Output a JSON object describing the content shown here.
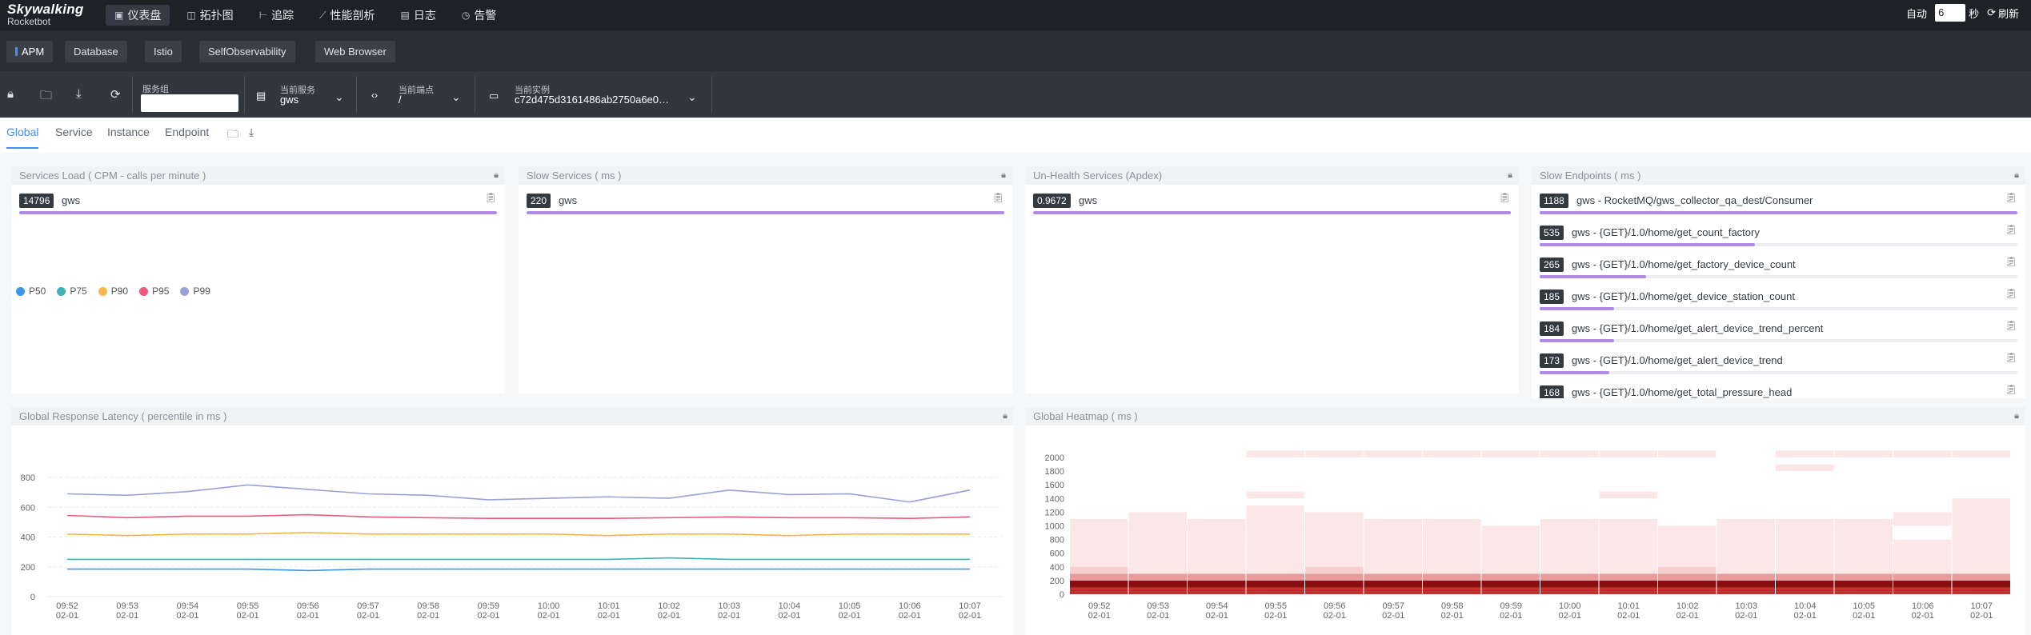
{
  "app": {
    "logo_main": "Skywalking",
    "logo_sub": "Rocketbot"
  },
  "nav": [
    {
      "label": "仪表盘",
      "icon": "dashboard-icon",
      "glyph": "▣",
      "active": true
    },
    {
      "label": "拓扑图",
      "icon": "topology-icon",
      "glyph": "◫"
    },
    {
      "label": "追踪",
      "icon": "trace-icon",
      "glyph": "⊢"
    },
    {
      "label": "性能剖析",
      "icon": "profile-icon",
      "glyph": "⟋"
    },
    {
      "label": "日志",
      "icon": "log-icon",
      "glyph": "▤"
    },
    {
      "label": "告警",
      "icon": "alarm-icon",
      "glyph": "◷"
    }
  ],
  "refresh": {
    "auto_label": "自动",
    "interval_value": "6",
    "unit_label": "秒",
    "refresh_label": "刷新"
  },
  "templates": [
    "APM",
    "Database",
    "Istio",
    "SelfObservability",
    "Web Browser"
  ],
  "selectors": {
    "group": {
      "label": "服务组",
      "value": ""
    },
    "service": {
      "label": "当前服务",
      "value": "gws"
    },
    "endpoint": {
      "label": "当前端点",
      "value": "/"
    },
    "instance": {
      "label": "当前实例",
      "value": "c72d475d3161486ab2750a6e0…"
    }
  },
  "dash_tabs": [
    "Global",
    "Service",
    "Instance",
    "Endpoint"
  ],
  "widgets": {
    "services_load": {
      "title": "Services Load ( CPM - calls per minute )",
      "items": [
        {
          "value": "14796",
          "name": "gws",
          "ratio": 1.0
        }
      ]
    },
    "slow_services": {
      "title": "Slow Services ( ms )",
      "items": [
        {
          "value": "220",
          "name": "gws",
          "ratio": 1.0
        }
      ]
    },
    "unhealth_services": {
      "title": "Un-Health Services (Apdex)",
      "items": [
        {
          "value": "0.9672",
          "name": "gws",
          "ratio": 1.0
        }
      ]
    },
    "slow_endpoints": {
      "title": "Slow Endpoints ( ms )",
      "items": [
        {
          "value": "1188",
          "name": "gws - RocketMQ/gws_collector_qa_dest/Consumer",
          "ratio": 1.0
        },
        {
          "value": "535",
          "name": "gws - {GET}/1.0/home/get_count_factory",
          "ratio": 0.45
        },
        {
          "value": "265",
          "name": "gws - {GET}/1.0/home/get_factory_device_count",
          "ratio": 0.223
        },
        {
          "value": "185",
          "name": "gws - {GET}/1.0/home/get_device_station_count",
          "ratio": 0.156
        },
        {
          "value": "184",
          "name": "gws - {GET}/1.0/home/get_alert_device_trend_percent",
          "ratio": 0.155
        },
        {
          "value": "173",
          "name": "gws - {GET}/1.0/home/get_alert_device_trend",
          "ratio": 0.146
        },
        {
          "value": "168",
          "name": "gws - {GET}/1.0/home/get_total_pressure_head",
          "ratio": 0.141
        }
      ]
    },
    "latency": {
      "title": "Global Response Latency ( percentile in ms )"
    },
    "heatmap": {
      "title": "Global Heatmap ( ms )"
    }
  },
  "chart_data": [
    {
      "type": "line",
      "title": "Global Response Latency ( percentile in ms )",
      "x": [
        "09:52\n02-01",
        "09:53\n02-01",
        "09:54\n02-01",
        "09:55\n02-01",
        "09:56\n02-01",
        "09:57\n02-01",
        "09:58\n02-01",
        "09:59\n02-01",
        "10:00\n02-01",
        "10:01\n02-01",
        "10:02\n02-01",
        "10:03\n02-01",
        "10:04\n02-01",
        "10:05\n02-01",
        "10:06\n02-01",
        "10:07\n02-01"
      ],
      "x_time": [
        "09:52",
        "09:53",
        "09:54",
        "09:55",
        "09:56",
        "09:57",
        "09:58",
        "09:59",
        "10:00",
        "10:01",
        "10:02",
        "10:03",
        "10:04",
        "10:05",
        "10:06",
        "10:07"
      ],
      "x_date": "02-01",
      "ylim": [
        0,
        800
      ],
      "yticks": [
        0,
        200,
        400,
        600,
        800
      ],
      "series": [
        {
          "name": "P50",
          "color": "#3f97e8",
          "values": [
            185,
            185,
            185,
            185,
            175,
            185,
            185,
            185,
            185,
            185,
            185,
            185,
            185,
            185,
            185,
            185
          ]
        },
        {
          "name": "P75",
          "color": "#3fb3b3",
          "values": [
            250,
            250,
            250,
            250,
            250,
            250,
            250,
            250,
            250,
            250,
            260,
            250,
            250,
            250,
            250,
            250
          ]
        },
        {
          "name": "P90",
          "color": "#f5b748",
          "values": [
            420,
            410,
            420,
            420,
            430,
            420,
            420,
            420,
            420,
            410,
            420,
            420,
            410,
            420,
            420,
            420
          ]
        },
        {
          "name": "P95",
          "color": "#ec5a7a",
          "values": [
            545,
            530,
            540,
            540,
            550,
            535,
            530,
            525,
            525,
            525,
            530,
            535,
            530,
            530,
            525,
            535
          ]
        },
        {
          "name": "P99",
          "color": "#9aa0dc",
          "values": [
            690,
            680,
            705,
            750,
            720,
            690,
            680,
            650,
            660,
            670,
            660,
            715,
            685,
            690,
            635,
            715
          ]
        }
      ]
    },
    {
      "type": "heatmap",
      "title": "Global Heatmap ( ms )",
      "x": [
        "09:52\n02-01",
        "09:53\n02-01",
        "09:54\n02-01",
        "09:55\n02-01",
        "09:56\n02-01",
        "09:57\n02-01",
        "09:58\n02-01",
        "09:59\n02-01",
        "10:00\n02-01",
        "10:01\n02-01",
        "10:02\n02-01",
        "10:03\n02-01",
        "10:04\n02-01",
        "10:05\n02-01",
        "10:06\n02-01",
        "10:07\n02-01"
      ],
      "x_time": [
        "09:52",
        "09:53",
        "09:54",
        "09:55",
        "09:56",
        "09:57",
        "09:58",
        "09:59",
        "10:00",
        "10:01",
        "10:02",
        "10:03",
        "10:04",
        "10:05",
        "10:06",
        "10:07"
      ],
      "x_date": "02-01",
      "ylim": [
        0,
        2000
      ],
      "yticks": [
        0,
        200,
        400,
        600,
        800,
        1000,
        1200,
        1400,
        1600,
        1800,
        2000
      ],
      "bucket_size": 100,
      "cells": [
        [
          0,
          0,
          4
        ],
        [
          0,
          1,
          5
        ],
        [
          0,
          2,
          3
        ],
        [
          0,
          3,
          2
        ],
        [
          0,
          4,
          1
        ],
        [
          0,
          5,
          1
        ],
        [
          0,
          6,
          1
        ],
        [
          0,
          7,
          1
        ],
        [
          0,
          8,
          1
        ],
        [
          0,
          9,
          1
        ],
        [
          0,
          10,
          1
        ],
        [
          1,
          0,
          4
        ],
        [
          1,
          1,
          5
        ],
        [
          1,
          2,
          3
        ],
        [
          1,
          3,
          1
        ],
        [
          1,
          4,
          1
        ],
        [
          1,
          5,
          1
        ],
        [
          1,
          6,
          1
        ],
        [
          1,
          7,
          1
        ],
        [
          1,
          8,
          1
        ],
        [
          1,
          9,
          1
        ],
        [
          1,
          10,
          1
        ],
        [
          1,
          11,
          1
        ],
        [
          2,
          0,
          4
        ],
        [
          2,
          1,
          5
        ],
        [
          2,
          2,
          3
        ],
        [
          2,
          3,
          1
        ],
        [
          2,
          4,
          1
        ],
        [
          2,
          5,
          1
        ],
        [
          2,
          6,
          1
        ],
        [
          2,
          7,
          1
        ],
        [
          2,
          8,
          1
        ],
        [
          2,
          9,
          1
        ],
        [
          2,
          10,
          1
        ],
        [
          3,
          0,
          4
        ],
        [
          3,
          1,
          5
        ],
        [
          3,
          2,
          3
        ],
        [
          3,
          3,
          1
        ],
        [
          3,
          4,
          1
        ],
        [
          3,
          5,
          1
        ],
        [
          3,
          6,
          1
        ],
        [
          3,
          7,
          1
        ],
        [
          3,
          8,
          1
        ],
        [
          3,
          9,
          1
        ],
        [
          3,
          10,
          1
        ],
        [
          3,
          11,
          1
        ],
        [
          3,
          12,
          1
        ],
        [
          3,
          14,
          1
        ],
        [
          3,
          20,
          1
        ],
        [
          4,
          0,
          4
        ],
        [
          4,
          1,
          5
        ],
        [
          4,
          2,
          3
        ],
        [
          4,
          3,
          2
        ],
        [
          4,
          4,
          1
        ],
        [
          4,
          5,
          1
        ],
        [
          4,
          6,
          1
        ],
        [
          4,
          7,
          1
        ],
        [
          4,
          8,
          1
        ],
        [
          4,
          9,
          1
        ],
        [
          4,
          10,
          1
        ],
        [
          4,
          11,
          1
        ],
        [
          4,
          20,
          1
        ],
        [
          5,
          0,
          4
        ],
        [
          5,
          1,
          5
        ],
        [
          5,
          2,
          3
        ],
        [
          5,
          3,
          1
        ],
        [
          5,
          4,
          1
        ],
        [
          5,
          5,
          1
        ],
        [
          5,
          6,
          1
        ],
        [
          5,
          7,
          1
        ],
        [
          5,
          8,
          1
        ],
        [
          5,
          9,
          1
        ],
        [
          5,
          10,
          1
        ],
        [
          5,
          20,
          1
        ],
        [
          6,
          0,
          4
        ],
        [
          6,
          1,
          5
        ],
        [
          6,
          2,
          3
        ],
        [
          6,
          3,
          1
        ],
        [
          6,
          4,
          1
        ],
        [
          6,
          5,
          1
        ],
        [
          6,
          6,
          1
        ],
        [
          6,
          7,
          1
        ],
        [
          6,
          8,
          1
        ],
        [
          6,
          9,
          1
        ],
        [
          6,
          10,
          1
        ],
        [
          6,
          20,
          1
        ],
        [
          7,
          0,
          4
        ],
        [
          7,
          1,
          5
        ],
        [
          7,
          2,
          3
        ],
        [
          7,
          3,
          1
        ],
        [
          7,
          4,
          1
        ],
        [
          7,
          5,
          1
        ],
        [
          7,
          6,
          1
        ],
        [
          7,
          7,
          1
        ],
        [
          7,
          8,
          1
        ],
        [
          7,
          9,
          1
        ],
        [
          7,
          20,
          1
        ],
        [
          8,
          0,
          4
        ],
        [
          8,
          1,
          5
        ],
        [
          8,
          2,
          3
        ],
        [
          8,
          3,
          1
        ],
        [
          8,
          4,
          1
        ],
        [
          8,
          5,
          1
        ],
        [
          8,
          6,
          1
        ],
        [
          8,
          7,
          1
        ],
        [
          8,
          8,
          1
        ],
        [
          8,
          9,
          1
        ],
        [
          8,
          10,
          1
        ],
        [
          8,
          20,
          1
        ],
        [
          9,
          0,
          4
        ],
        [
          9,
          1,
          5
        ],
        [
          9,
          2,
          3
        ],
        [
          9,
          3,
          1
        ],
        [
          9,
          4,
          1
        ],
        [
          9,
          5,
          1
        ],
        [
          9,
          6,
          1
        ],
        [
          9,
          7,
          1
        ],
        [
          9,
          8,
          1
        ],
        [
          9,
          9,
          1
        ],
        [
          9,
          10,
          1
        ],
        [
          9,
          14,
          1
        ],
        [
          9,
          20,
          1
        ],
        [
          10,
          0,
          4
        ],
        [
          10,
          1,
          5
        ],
        [
          10,
          2,
          3
        ],
        [
          10,
          3,
          2
        ],
        [
          10,
          4,
          1
        ],
        [
          10,
          5,
          1
        ],
        [
          10,
          6,
          1
        ],
        [
          10,
          7,
          1
        ],
        [
          10,
          8,
          1
        ],
        [
          10,
          9,
          1
        ],
        [
          10,
          20,
          1
        ],
        [
          11,
          0,
          4
        ],
        [
          11,
          1,
          5
        ],
        [
          11,
          2,
          3
        ],
        [
          11,
          3,
          1
        ],
        [
          11,
          4,
          1
        ],
        [
          11,
          5,
          1
        ],
        [
          11,
          6,
          1
        ],
        [
          11,
          7,
          1
        ],
        [
          11,
          8,
          1
        ],
        [
          11,
          9,
          1
        ],
        [
          11,
          10,
          1
        ],
        [
          12,
          0,
          4
        ],
        [
          12,
          1,
          5
        ],
        [
          12,
          2,
          3
        ],
        [
          12,
          3,
          1
        ],
        [
          12,
          4,
          1
        ],
        [
          12,
          5,
          1
        ],
        [
          12,
          6,
          1
        ],
        [
          12,
          7,
          1
        ],
        [
          12,
          8,
          1
        ],
        [
          12,
          9,
          1
        ],
        [
          12,
          10,
          1
        ],
        [
          12,
          18,
          1
        ],
        [
          12,
          20,
          1
        ],
        [
          13,
          0,
          4
        ],
        [
          13,
          1,
          5
        ],
        [
          13,
          2,
          3
        ],
        [
          13,
          3,
          1
        ],
        [
          13,
          4,
          1
        ],
        [
          13,
          5,
          1
        ],
        [
          13,
          6,
          1
        ],
        [
          13,
          7,
          1
        ],
        [
          13,
          8,
          1
        ],
        [
          13,
          9,
          1
        ],
        [
          13,
          10,
          1
        ],
        [
          13,
          20,
          1
        ],
        [
          14,
          0,
          4
        ],
        [
          14,
          1,
          5
        ],
        [
          14,
          2,
          3
        ],
        [
          14,
          3,
          1
        ],
        [
          14,
          4,
          1
        ],
        [
          14,
          5,
          1
        ],
        [
          14,
          6,
          1
        ],
        [
          14,
          7,
          1
        ],
        [
          14,
          10,
          1
        ],
        [
          14,
          11,
          1
        ],
        [
          14,
          20,
          1
        ],
        [
          15,
          0,
          4
        ],
        [
          15,
          1,
          5
        ],
        [
          15,
          2,
          3
        ],
        [
          15,
          3,
          1
        ],
        [
          15,
          4,
          1
        ],
        [
          15,
          5,
          1
        ],
        [
          15,
          6,
          1
        ],
        [
          15,
          7,
          1
        ],
        [
          15,
          8,
          1
        ],
        [
          15,
          9,
          1
        ],
        [
          15,
          10,
          1
        ],
        [
          15,
          11,
          1
        ],
        [
          15,
          12,
          1
        ],
        [
          15,
          13,
          1
        ],
        [
          15,
          20,
          1
        ]
      ]
    }
  ]
}
